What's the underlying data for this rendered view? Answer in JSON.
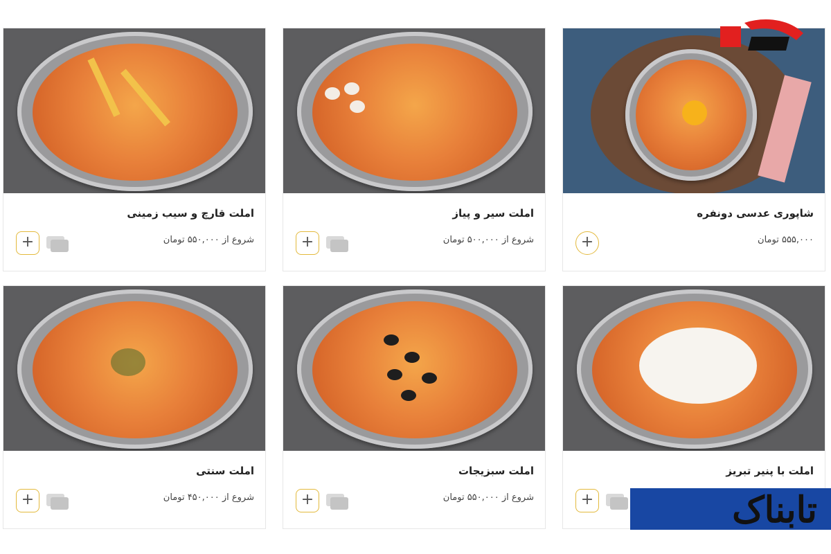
{
  "products": [
    {
      "title": "شاپوری عدسی دونفره",
      "price": "۵۵۵,۰۰۰ تومان",
      "add": "+",
      "compare": false
    },
    {
      "title": "املت سیر و پیاز",
      "price": "شروع از ۵۰۰,۰۰۰ تومان",
      "add": "+",
      "compare": true
    },
    {
      "title": "املت قارچ و سیب زمینی",
      "price": "شروع از ۵۵۰,۰۰۰ تومان",
      "add": "+",
      "compare": true
    },
    {
      "title": "املت با پنیر تبریز",
      "price": "",
      "add": "+",
      "compare": true
    },
    {
      "title": "املت سبزیجات",
      "price": "شروع از ۵۵۰,۰۰۰ تومان",
      "add": "+",
      "compare": true
    },
    {
      "title": "املت سنتی",
      "price": "شروع از ۴۵۰,۰۰۰ تومان",
      "add": "+",
      "compare": true
    }
  ],
  "watermarks": {
    "bottom_logo_text": "تابناک"
  },
  "colors": {
    "button_border": "#e3b93b",
    "photo_background": "#5d5d5f",
    "watermark_blue": "#1847a3",
    "watermark_red": "#e2201f"
  }
}
